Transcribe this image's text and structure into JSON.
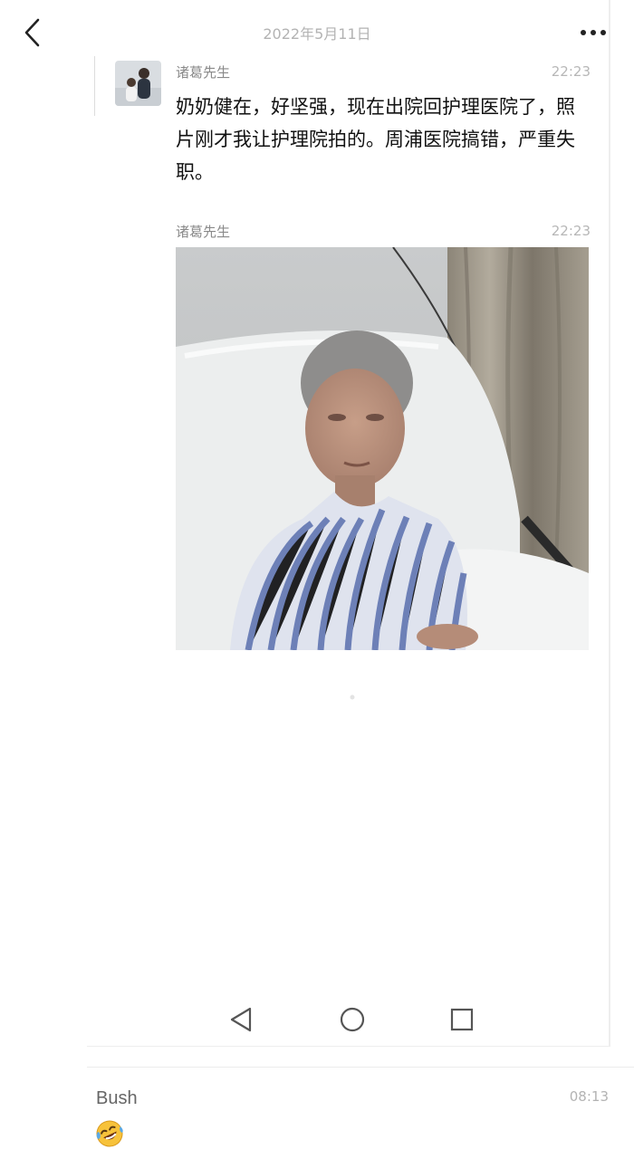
{
  "header": {
    "date": "2022年5月11日",
    "back_icon": "chevron-left-icon",
    "more_icon": "more-horizontal-icon"
  },
  "messages": [
    {
      "sender": "诸葛先生",
      "time": "22:23",
      "text": "奶奶健在，好坚强，现在出院回护理医院了，照片刚才我让护理院拍的。周浦医院搞错，严重失职。"
    },
    {
      "sender": "诸葛先生",
      "time": "22:23",
      "image": "photo-elderly-woman-in-hospital-bed"
    }
  ],
  "navbar": {
    "icons": [
      "back-triangle-icon",
      "home-circle-icon",
      "recents-square-icon"
    ]
  },
  "comment": {
    "name": "Bush",
    "time": "08:13",
    "emoji": "laughing-crying-emoji-icon"
  },
  "colors": {
    "text_primary": "#111111",
    "text_secondary": "#8a8a8a",
    "timestamp": "#b7b7b7"
  }
}
